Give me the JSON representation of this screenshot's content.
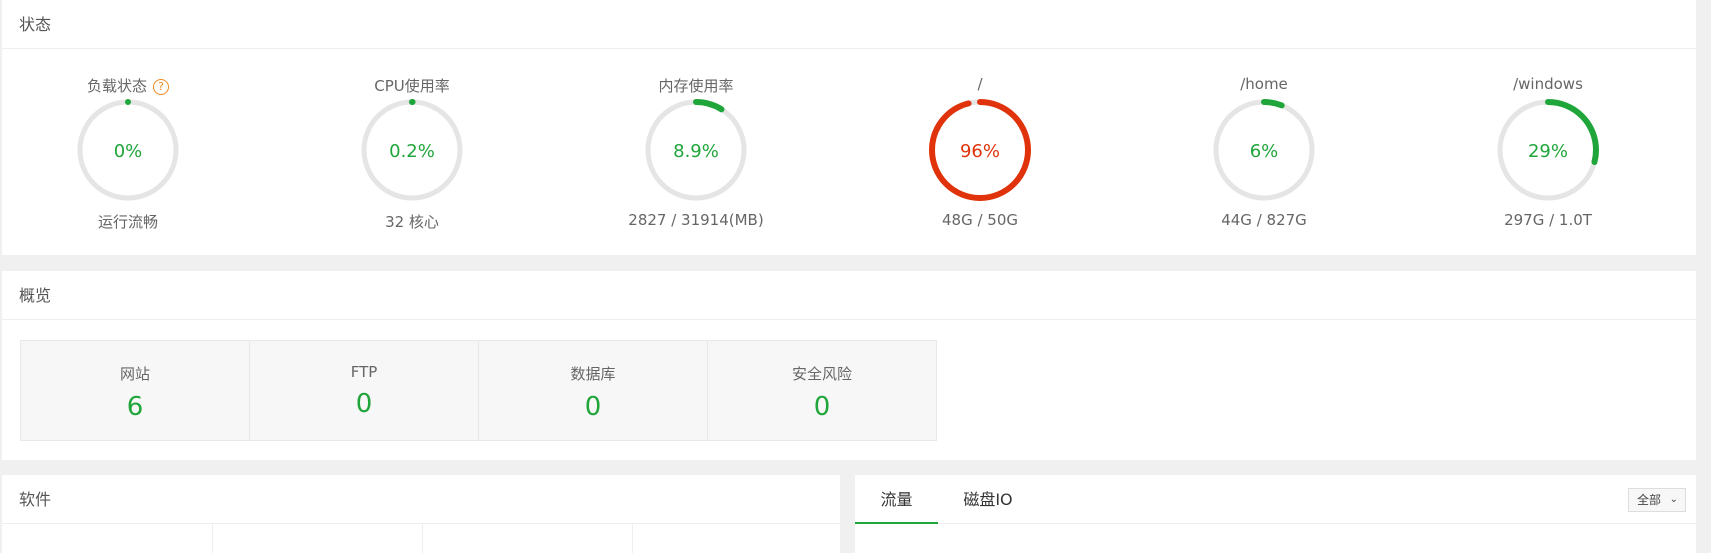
{
  "status": {
    "title": "状态",
    "gauges": [
      {
        "title": "负载状态",
        "value": "0%",
        "percent": 0,
        "sub": "运行流畅",
        "help": "?"
      },
      {
        "title": "CPU使用率",
        "value": "0.2%",
        "percent": 0.2,
        "sub": "32 核心"
      },
      {
        "title": "内存使用率",
        "value": "8.9%",
        "percent": 8.9,
        "sub": "2827 / 31914(MB)"
      },
      {
        "title": "/",
        "value": "96%",
        "percent": 96,
        "sub": "48G / 50G"
      },
      {
        "title": "/home",
        "value": "6%",
        "percent": 6,
        "sub": "44G / 827G"
      },
      {
        "title": "/windows",
        "value": "29%",
        "percent": 29,
        "sub": "297G / 1.0T"
      }
    ]
  },
  "overview": {
    "title": "概览",
    "cards": [
      {
        "label": "网站",
        "value": "6"
      },
      {
        "label": "FTP",
        "value": "0"
      },
      {
        "label": "数据库",
        "value": "0"
      },
      {
        "label": "安全风险",
        "value": "0"
      }
    ]
  },
  "software": {
    "title": "软件"
  },
  "traffic": {
    "tabs": [
      "流量",
      "磁盘IO"
    ],
    "select_value": "全部"
  },
  "colors": {
    "green": "#20a53a",
    "red": "#e0330c",
    "track": "#e5e5e5"
  }
}
